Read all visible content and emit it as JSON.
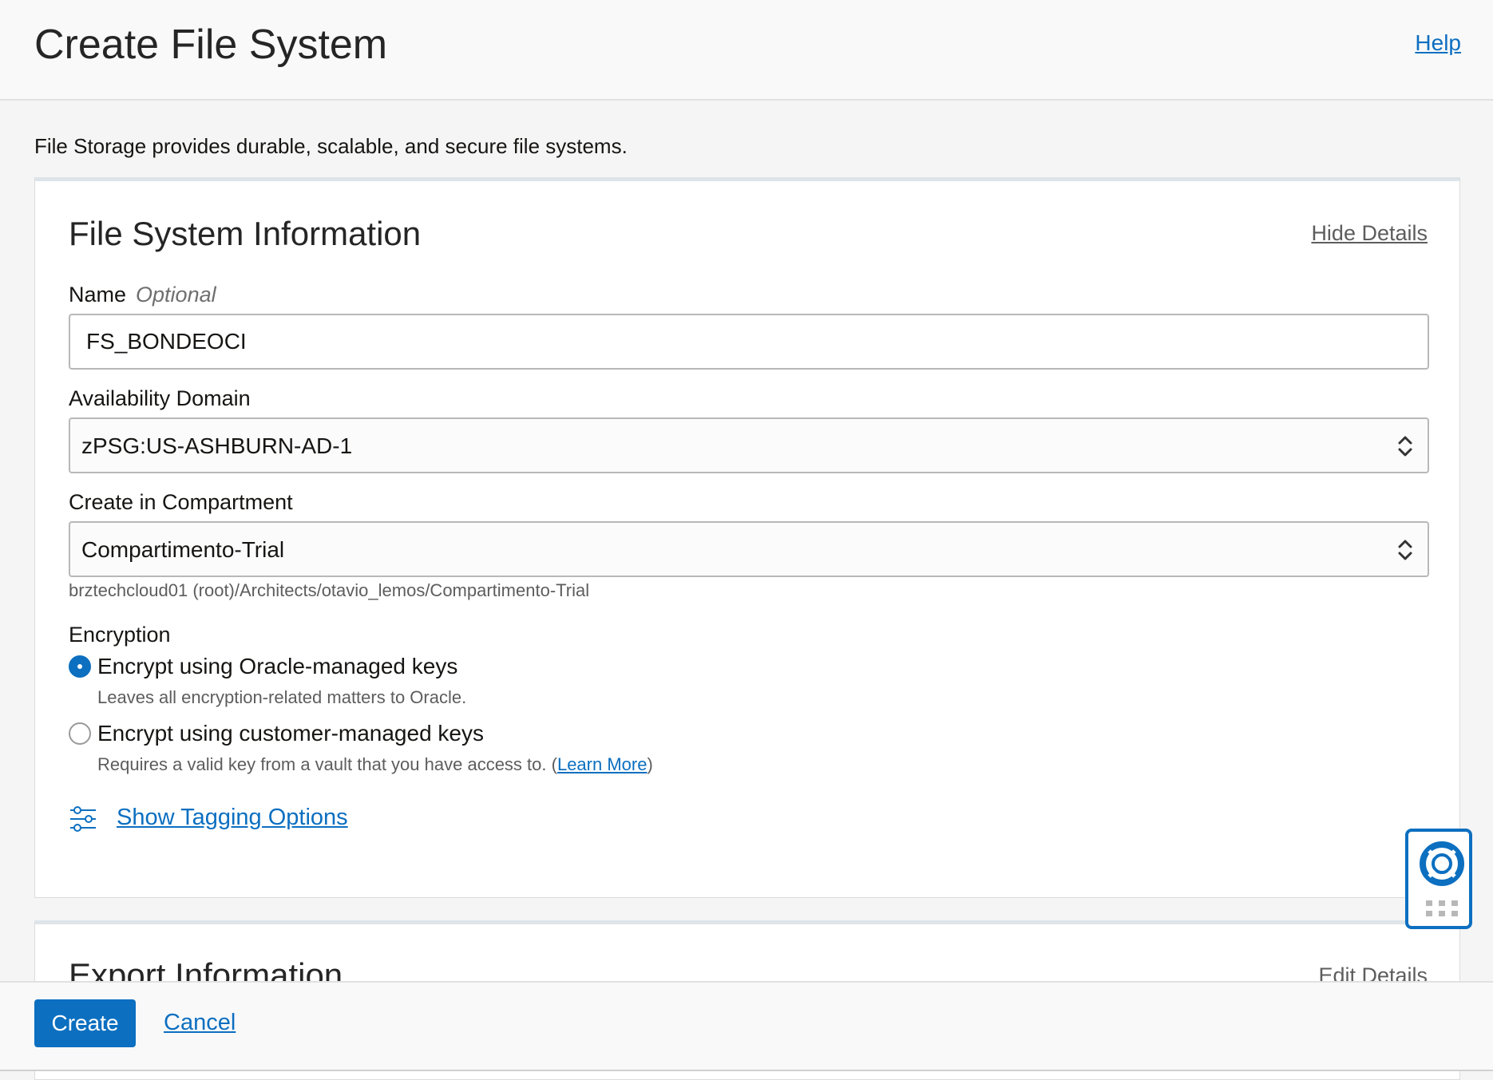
{
  "header": {
    "title": "Create File System",
    "help_label": "Help"
  },
  "intro": "File Storage provides durable, scalable, and secure file systems.",
  "file_system_info": {
    "title": "File System Information",
    "toggle_label": "Hide Details",
    "name": {
      "label": "Name",
      "optional_label": "Optional",
      "value": "FS_BONDEOCI"
    },
    "availability_domain": {
      "label": "Availability Domain",
      "value": "zPSG:US-ASHBURN-AD-1"
    },
    "compartment": {
      "label": "Create in Compartment",
      "value": "Compartimento-Trial",
      "path": "brztechcloud01 (root)/Architects/otavio_lemos/Compartimento-Trial"
    },
    "encryption": {
      "label": "Encryption",
      "options": [
        {
          "label": "Encrypt using Oracle-managed keys",
          "description": "Leaves all encryption-related matters to Oracle.",
          "selected": true
        },
        {
          "label": "Encrypt using customer-managed keys",
          "description": "Requires a valid key from a vault that you have access to. (",
          "link_label": "Learn More",
          "suffix": ")",
          "selected": false
        }
      ]
    },
    "tagging_label": "Show Tagging Options"
  },
  "export_info": {
    "title": "Export Information",
    "action_label": "Edit Details"
  },
  "footer": {
    "create_label": "Create",
    "cancel_label": "Cancel"
  },
  "colors": {
    "accent": "#0c6fc0",
    "header_bg": "#f9f9f9",
    "page_bg": "#f5f5f5"
  },
  "icons": {
    "help_widget": "lifebuoy-icon",
    "grip": "grip-icon",
    "tagging": "sliders-icon",
    "select": "updown-chevron-icon"
  }
}
